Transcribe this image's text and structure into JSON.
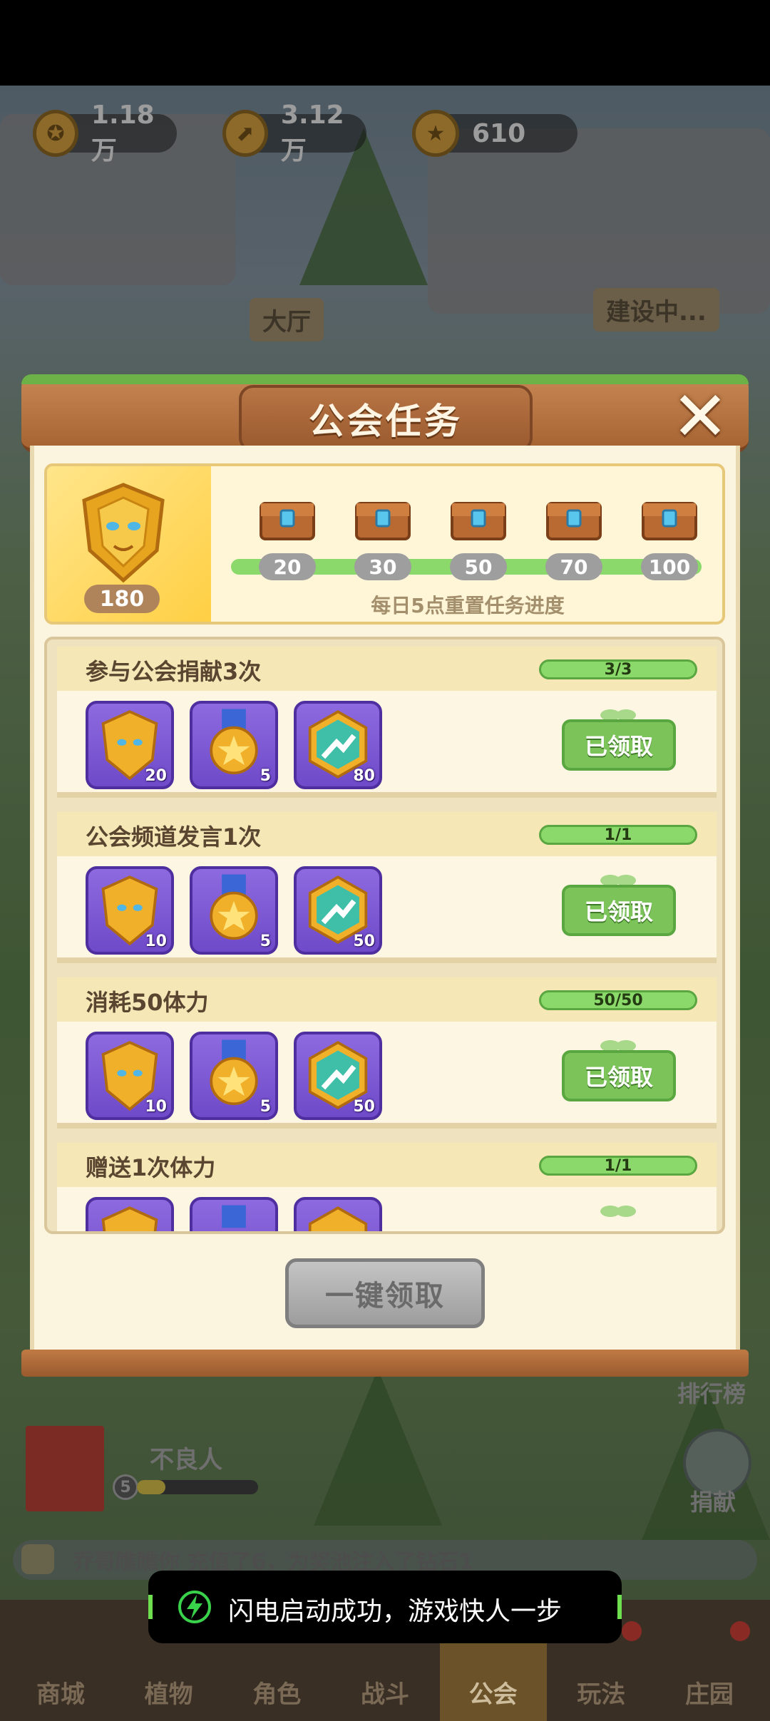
{
  "resources": [
    {
      "icon": "gold-coin-icon",
      "value": "1.18万"
    },
    {
      "icon": "exp-arrow-icon",
      "value": "3.12万"
    },
    {
      "icon": "star-medal-icon",
      "value": "610"
    }
  ],
  "background": {
    "hall_sign": "大厅",
    "building_sign": "建设中..."
  },
  "modal": {
    "title": "公会任务",
    "badge_points": "180",
    "milestones": [
      "20",
      "30",
      "50",
      "70",
      "100"
    ],
    "reset_note": "每日5点重置任务进度",
    "claim_all_label": "一键领取",
    "tasks": [
      {
        "title": "参与公会捐献3次",
        "progress": "3/3",
        "rewards": [
          "20",
          "5",
          "80"
        ],
        "status": "已领取"
      },
      {
        "title": "公会频道发言1次",
        "progress": "1/1",
        "rewards": [
          "10",
          "5",
          "50"
        ],
        "status": "已领取"
      },
      {
        "title": "消耗50体力",
        "progress": "50/50",
        "rewards": [
          "10",
          "5",
          "50"
        ],
        "status": "已领取"
      },
      {
        "title": "赠送1次体力",
        "progress": "1/1",
        "rewards": [
          "",
          "",
          ""
        ],
        "status": ""
      }
    ]
  },
  "guild": {
    "name": "不良人",
    "level": "5"
  },
  "side": {
    "rank_label": "排行榜",
    "donate_label": "捐献"
  },
  "chat": {
    "message": "乔哥瞧瞧你 充值了6，为奖池注入了钻石1"
  },
  "toast": {
    "message": "闪电启动成功，游戏快人一步"
  },
  "nav": [
    "商城",
    "植物",
    "角色",
    "战斗",
    "公会",
    "玩法",
    "庄园"
  ],
  "colors": {
    "accent_green": "#8bd96a",
    "modal_wood": "#b87545",
    "reward_purple": "#7a55d6"
  }
}
